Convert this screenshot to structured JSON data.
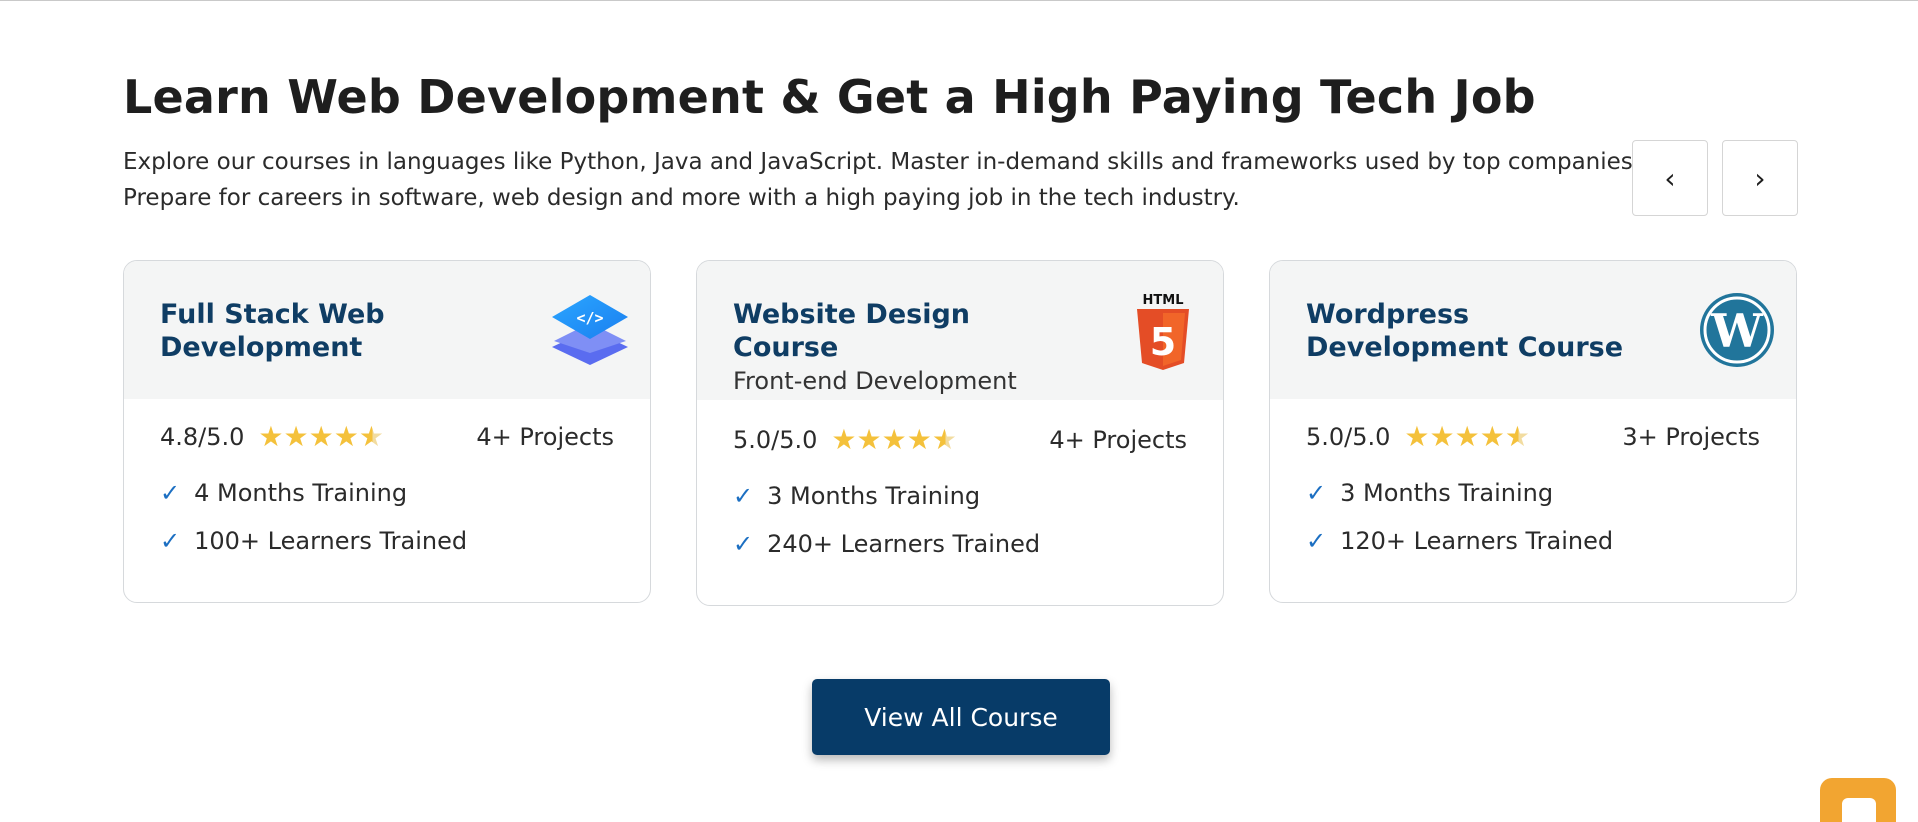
{
  "section": {
    "title": "Learn Web Development & Get a High Paying Tech Job",
    "description": "Explore our courses in languages like Python, Java and JavaScript. Master in-demand skills and frameworks used by top companies. Prepare for careers in software, web design and more with a high paying job in the tech industry."
  },
  "carousel": {
    "prev_label": "‹",
    "next_label": "›"
  },
  "cards": [
    {
      "title": "Full Stack Web Development",
      "subtitle": "",
      "logo": "code-layers-icon",
      "rating": "4.8/5.0",
      "rating_value": 4.8,
      "projects": "4+ Projects",
      "features": [
        "4 Months Training",
        "100+ Learners Trained"
      ]
    },
    {
      "title": "Website Design Course",
      "subtitle": "Front-end Development",
      "logo": "html5-icon",
      "logo_text": "HTML",
      "logo_number": "5",
      "rating": "5.0/5.0",
      "rating_value": 5.0,
      "projects": "4+ Projects",
      "features": [
        "3 Months Training",
        "240+ Learners Trained"
      ]
    },
    {
      "title": "Wordpress Development Course",
      "subtitle": "",
      "logo": "wordpress-icon",
      "rating": "5.0/5.0",
      "rating_value": 5.0,
      "projects": "3+ Projects",
      "features": [
        "3 Months Training",
        "120+ Learners Trained"
      ]
    }
  ],
  "cta": {
    "label": "View All Course"
  },
  "colors": {
    "brand_navy": "#073b68",
    "title_blue": "#0f3d64",
    "star": "#f4c13b",
    "check": "#1c6fc2",
    "chat_widget": "#f2a531"
  },
  "icons": {
    "check": "✓",
    "star": "★"
  }
}
